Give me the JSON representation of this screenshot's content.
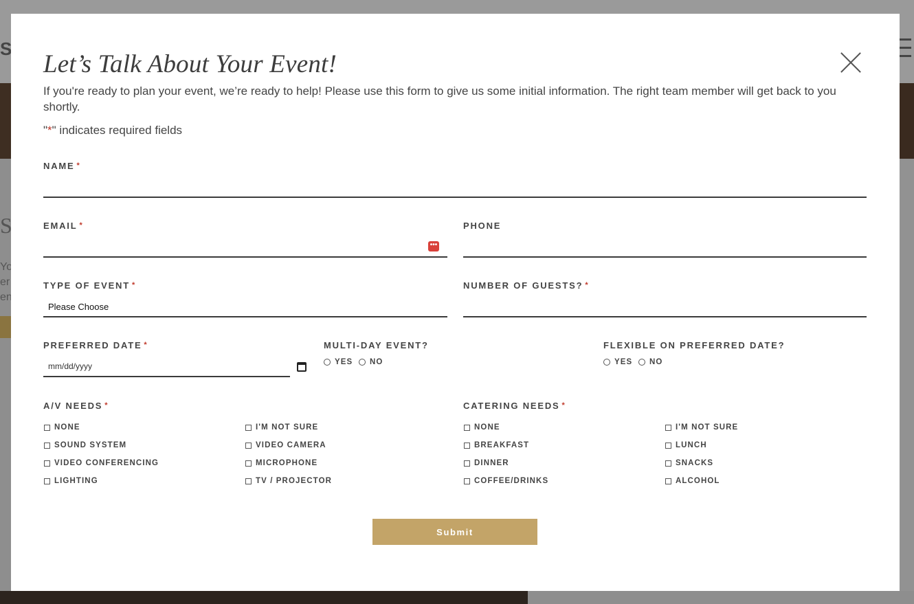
{
  "background": {
    "logo_text": "S!",
    "side_heading": "Se",
    "side_lines": [
      "You",
      "er",
      "en"
    ]
  },
  "modal": {
    "title": "Let’s Talk About Your Event!",
    "intro": "If you're ready to plan your event, we’re ready to help! Please use this form to give us some initial information. The right team member will get back to you shortly.",
    "required_note_prefix": "\"",
    "required_note_marker": "*",
    "required_note_suffix": "\" indicates required fields",
    "close_label": "×"
  },
  "form": {
    "required_marker": "*",
    "name_label": "Name",
    "email_label": "Email",
    "phone_label": "Phone",
    "event_type_label": "Type of Event",
    "event_type_value": "Please Choose",
    "guests_label": "Number of Guests?",
    "preferred_date_label": "Preferred Date",
    "preferred_date_placeholder": "mm/dd/yyyy",
    "multi_day_label": "Multi-Day Event?",
    "flexible_label": "Flexible on Preferred Date?",
    "yes": "Yes",
    "no": "No",
    "av_label": "A/V Needs",
    "av_options": [
      "None",
      "I'm Not Sure",
      "Sound System",
      "Video Camera",
      "Video Conferencing",
      "Microphone",
      "Lighting",
      "TV / Projector"
    ],
    "catering_label": "Catering Needs",
    "catering_options": [
      "None",
      "I'm Not Sure",
      "Breakfast",
      "Lunch",
      "Dinner",
      "Snacks",
      "Coffee/Drinks",
      "Alcohol"
    ],
    "submit_label": "Submit",
    "password_icon_text": "•••"
  },
  "colors": {
    "accent": "#c3a468",
    "required": "#c0392b",
    "overlay": "#8e8e8e"
  }
}
